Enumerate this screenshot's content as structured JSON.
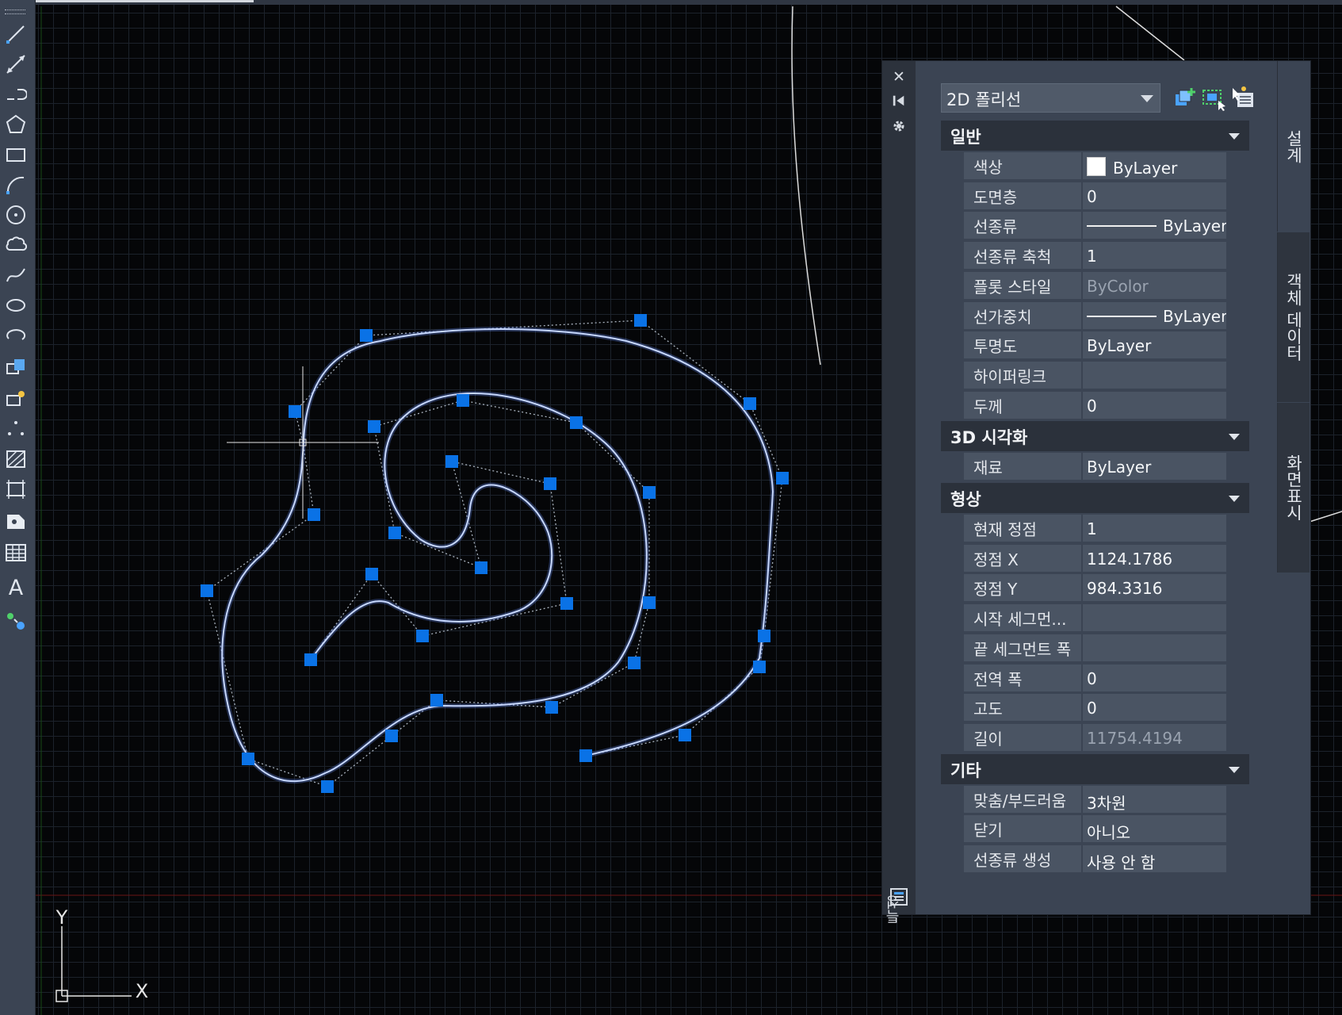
{
  "left_toolbar": {
    "tools": [
      {
        "name": "line-tool"
      },
      {
        "name": "xline-tool"
      },
      {
        "name": "polyline-tool"
      },
      {
        "name": "polygon-tool"
      },
      {
        "name": "rectangle-tool"
      },
      {
        "name": "arc-tool"
      },
      {
        "name": "circle-tool"
      },
      {
        "name": "revcloud-tool"
      },
      {
        "name": "spline-tool"
      },
      {
        "name": "ellipse-tool"
      },
      {
        "name": "ellipse-arc-tool"
      },
      {
        "name": "insert-block-tool"
      },
      {
        "name": "make-block-tool"
      },
      {
        "name": "point-tool"
      },
      {
        "name": "hatch-tool"
      },
      {
        "name": "gradient-tool"
      },
      {
        "name": "region-tool"
      },
      {
        "name": "table-tool"
      },
      {
        "name": "mtext-tool",
        "glyph": "A"
      },
      {
        "name": "add-selected-tool"
      }
    ]
  },
  "ucs_icon": {
    "y_label": "Y",
    "x_label": "X"
  },
  "palette": {
    "title": "특성",
    "close_glyph": "✕",
    "object_type": "2D 폴리선",
    "tabs": [
      "설계",
      "객체 데이터",
      "화면표시"
    ],
    "sections": [
      {
        "title": "일반",
        "rows": [
          {
            "name": "색상",
            "value": "ByLayer",
            "kind": "color",
            "color": "#ffffff"
          },
          {
            "name": "도면층",
            "value": "0"
          },
          {
            "name": "선종류",
            "value": "ByLayer",
            "kind": "line"
          },
          {
            "name": "선종류 축척",
            "value": "1"
          },
          {
            "name": "플롯 스타일",
            "value": "ByColor",
            "dim": true
          },
          {
            "name": "선가중치",
            "value": "ByLayer",
            "kind": "line"
          },
          {
            "name": "투명도",
            "value": "ByLayer"
          },
          {
            "name": "하이퍼링크",
            "value": ""
          },
          {
            "name": "두께",
            "value": "0"
          }
        ]
      },
      {
        "title": "3D 시각화",
        "rows": [
          {
            "name": "재료",
            "value": "ByLayer"
          }
        ]
      },
      {
        "title": "형상",
        "rows": [
          {
            "name": "현재 정점",
            "value": "1"
          },
          {
            "name": "정점 X",
            "value": "1124.1786"
          },
          {
            "name": "정점 Y",
            "value": "984.3316"
          },
          {
            "name": "시작 세그먼...",
            "value": ""
          },
          {
            "name": "끝 세그먼트 폭",
            "value": ""
          },
          {
            "name": "전역 폭",
            "value": "0"
          },
          {
            "name": "고도",
            "value": "0"
          },
          {
            "name": "길이",
            "value": "11754.4194",
            "dim": true
          }
        ]
      },
      {
        "title": "기타",
        "rows": [
          {
            "name": "맞춤/부드러움",
            "value": "3차원"
          },
          {
            "name": "닫기",
            "value": "아니오"
          },
          {
            "name": "선종류 생성",
            "value": "사용 안 함"
          }
        ]
      }
    ]
  },
  "colors": {
    "polyline": "#bcd2ff",
    "grip": "#0a72e6",
    "canvas": "#050608",
    "panel": "#3b4453"
  }
}
